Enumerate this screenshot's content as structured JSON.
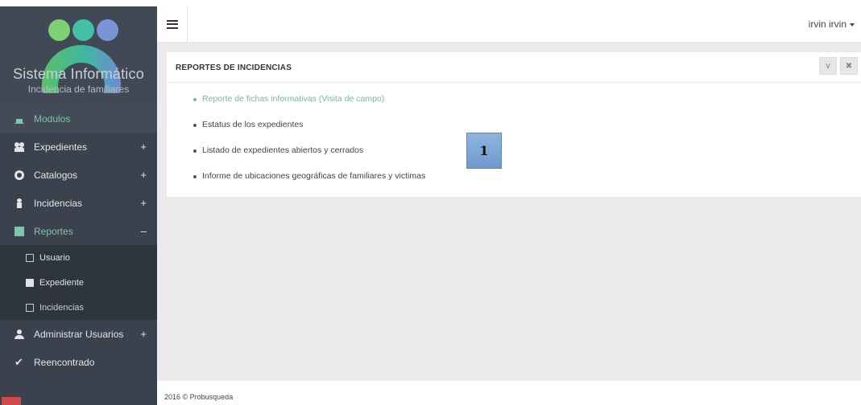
{
  "brand": {
    "title": "Sistema Informático",
    "subtitle": "Incidencia de familiares"
  },
  "nav": [
    {
      "label": "Modulos",
      "icon": "home-icon",
      "toggle": ""
    },
    {
      "label": "Expedientes",
      "icon": "users-icon",
      "toggle": "+"
    },
    {
      "label": "Catalogos",
      "icon": "gears-icon",
      "toggle": "+"
    },
    {
      "label": "Incidencias",
      "icon": "person-icon",
      "toggle": "+"
    },
    {
      "label": "Reportes",
      "icon": "file-icon",
      "toggle": "–"
    },
    {
      "label": "Administrar Usuarios",
      "icon": "user-icon",
      "toggle": "+"
    },
    {
      "label": "Reencontrado",
      "icon": "check-icon",
      "toggle": ""
    }
  ],
  "reportes_sub": [
    {
      "label": "Usuario",
      "icon": "file-o-icon"
    },
    {
      "label": "Expediente",
      "icon": "file-icon"
    },
    {
      "label": "Incidencias",
      "icon": "edit-icon"
    }
  ],
  "topbar": {
    "user": "irvin irvin"
  },
  "panel": {
    "title": "REPORTES DE INCIDENCIAS",
    "links": [
      "Reporte de fichas informativas (Visita de campo)",
      "Estatus de los expedientes",
      "Listado de expedientes abiertos y cerrados",
      "Informe de ubicaciones geográficas de familiares y victimas"
    ],
    "collapse_icon": "chevron-down-icon",
    "close_icon": "close-icon"
  },
  "badge": {
    "label": "1"
  },
  "footer": {
    "text": "2016 © Probusqueda"
  },
  "colors": {
    "sidebar": "#3b424d",
    "accent": "#7cc6a7",
    "submenu": "#2f353e",
    "badge": "#7ea6d8"
  }
}
